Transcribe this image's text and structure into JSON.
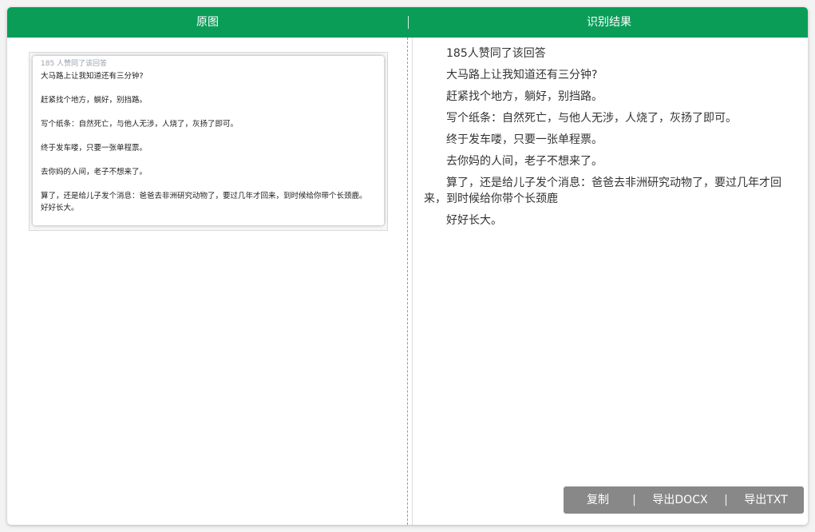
{
  "header": {
    "left_title": "原图",
    "separator": "|",
    "right_title": "识别结果"
  },
  "original": {
    "likes": "185 人赞同了该回答",
    "lines": [
      "大马路上让我知道还有三分钟?",
      "赶紧找个地方，躺好，别挡路。",
      "写个纸条：自然死亡，与他人无涉，人烧了，灰扬了即可。",
      "终于发车喽，只要一张单程票。",
      "去你妈的人间，老子不想来了。",
      "算了，还是给儿子发个消息：爸爸去非洲研究动物了，要过几年才回来，到时候给你带个长颈鹿。",
      "好好长大。"
    ]
  },
  "result": {
    "paragraphs": [
      "185人赞同了该回答",
      "大马路上让我知道还有三分钟?",
      "赶紧找个地方，躺好，别挡路。",
      "写个纸条：自然死亡，与他人无涉，人烧了，灰扬了即可。",
      "终于发车喽，只要一张单程票。",
      "去你妈的人间，老子不想来了。",
      "算了，还是给儿子发个消息：爸爸去非洲研究动物了，要过几年才回来，到时候给你带个长颈鹿",
      "好好长大。"
    ]
  },
  "actions": {
    "copy": "复制",
    "export_docx": "导出DOCX",
    "export_txt": "导出TXT",
    "separator": "|"
  },
  "colors": {
    "header_bg": "#0a9d58",
    "action_bar_bg": "#888888"
  }
}
